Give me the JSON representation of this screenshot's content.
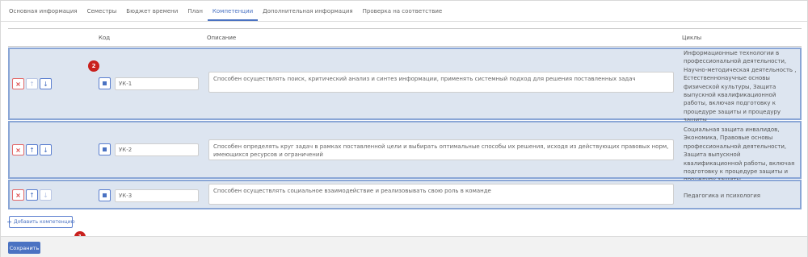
{
  "tabs": [
    "Основная информация",
    "Семестры",
    "Бюджет времени",
    "План",
    "Компетенции",
    "Дополнительная информация",
    "Проверка на соответствие"
  ],
  "table": {
    "headers": {
      "code": "Код",
      "description": "Описание",
      "cycles": "Циклы"
    },
    "rows": [
      {
        "code": "УК-1",
        "description": "Способен осуществлять поиск, критический анализ и синтез информации, применять системный подход для решения поставленных задач",
        "cycles": "Информационные технологии в профессиональной деятельности, Научно-методическая деятельность , Естественнонаучные основы физической культуры, Защита выпускной квалификационной работы, включая подготовку к процедуре защиты и процедуру защиты"
      },
      {
        "code": "УК-2",
        "description": "Способен определять круг задач в рамках поставленной цели и выбирать оптимальные способы их решения, исходя из действующих правовых норм, имеющихся ресурсов и ограничений",
        "cycles": "Социальная защита инвалидов, Экономика, Правовые основы профессиональной деятельности, Защита выпускной квалификационной работы, включая подготовку к процедуре защиты и процедуру защиты"
      },
      {
        "code": "УК-3",
        "description": "Способен осуществлять социальное взаимодействие и реализовывать свою роль в команде",
        "cycles": "Педагогика и психология"
      }
    ]
  },
  "buttons": {
    "delete": "×",
    "up": "↑",
    "down": "↓",
    "add_plus": "+",
    "add_competence": "Добавить компетенцию",
    "save": "Сохранить"
  },
  "markers": {
    "first": "1",
    "second": "2"
  },
  "colors": {
    "accent": "#4a72c2",
    "row_bg": "#dde5f0",
    "delete": "#d93b3b",
    "marker": "#c9211e"
  }
}
